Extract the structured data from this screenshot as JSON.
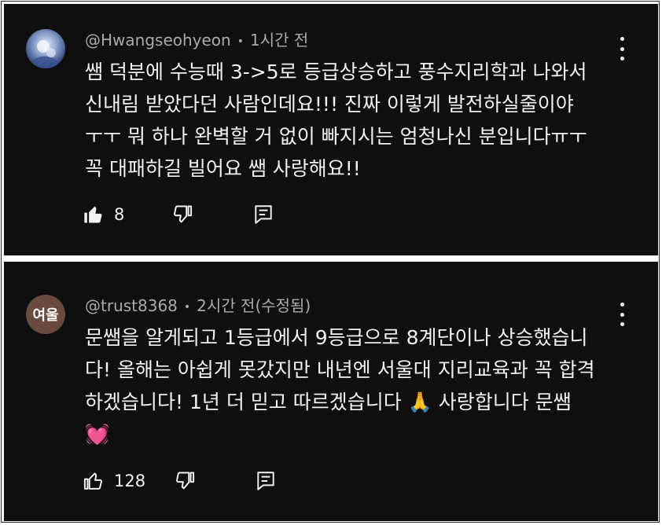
{
  "comments": [
    {
      "author": "@Hwangseohyeon",
      "time": "1시간 전",
      "avatar_text": "",
      "lines": [
        "쌤 덕분에 수능때 3->5로 등급상승하고 풍수지리학과 나와서",
        "신내림 받았다던 사람인데요!!! 진짜 이렇게 발전하실줄이야",
        "ㅜㅜ 뭐 하나 완벽할 거 없이 빠지시는 엄청나신 분입니다ㅠㅜ",
        "꼭 대패하길 빌어요 쌤 사랑해요!!"
      ],
      "like_count": "8",
      "liked": true
    },
    {
      "author": "@trust8368",
      "time": "2시간 전(수정됨)",
      "avatar_text": "여울",
      "lines": [
        "문쌤을 알게되고 1등급에서 9등급으로 8계단이나 상승했습니",
        "다! 올해는 아쉽게 못갔지만 내년엔 서울대 지리교육과 꼭 합격",
        "하겠습니다! 1년 더 믿고 따르겠습니다 🙏  사랑합니다 문쌤",
        "💓"
      ],
      "like_count": "128",
      "liked": false
    }
  ],
  "separator": "•",
  "colors": {
    "background": "#0f0f0f",
    "text": "#f1f1f1",
    "meta": "#aaaaaa",
    "avatar2": "#6a4a3e"
  },
  "icons": [
    "thumbs-up-icon",
    "thumbs-down-icon",
    "reply-icon",
    "more-vert-icon"
  ]
}
